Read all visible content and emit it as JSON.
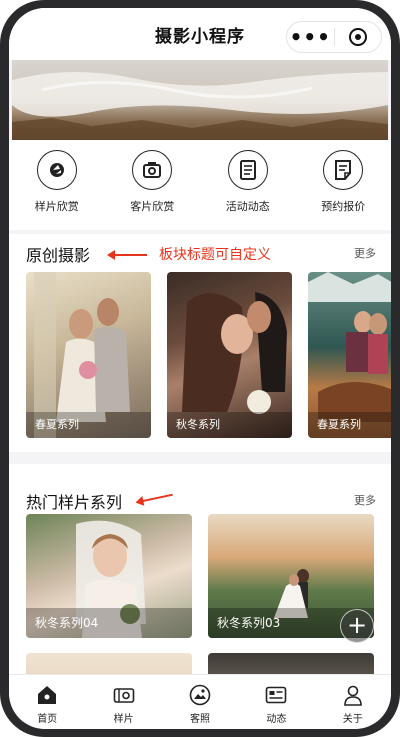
{
  "titlebar": {
    "title": "摄影小程序",
    "menu_label": "•••"
  },
  "nav": [
    {
      "label": "样片欣赏",
      "icon": "camera-lens-icon"
    },
    {
      "label": "客片欣赏",
      "icon": "camera-icon"
    },
    {
      "label": "活动动态",
      "icon": "document-icon"
    },
    {
      "label": "预约报价",
      "icon": "appointment-icon"
    }
  ],
  "section1": {
    "title": "原创摄影",
    "more": "更多",
    "annotation": "板块标题可自定义",
    "cards": [
      {
        "label": "春夏系列"
      },
      {
        "label": "秋冬系列"
      },
      {
        "label": "春夏系列"
      }
    ]
  },
  "section2": {
    "title": "热门样片系列",
    "more": "更多",
    "cards": [
      {
        "label": "秋冬系列04"
      },
      {
        "label": "秋冬系列03"
      }
    ],
    "fab": "+"
  },
  "tabbar": [
    {
      "label": "首页",
      "icon": "home-icon"
    },
    {
      "label": "样片",
      "icon": "camera-icon"
    },
    {
      "label": "客照",
      "icon": "photo-icon"
    },
    {
      "label": "动态",
      "icon": "news-icon"
    },
    {
      "label": "关于",
      "icon": "user-icon"
    }
  ],
  "colors": {
    "accent": "#e8341c"
  }
}
